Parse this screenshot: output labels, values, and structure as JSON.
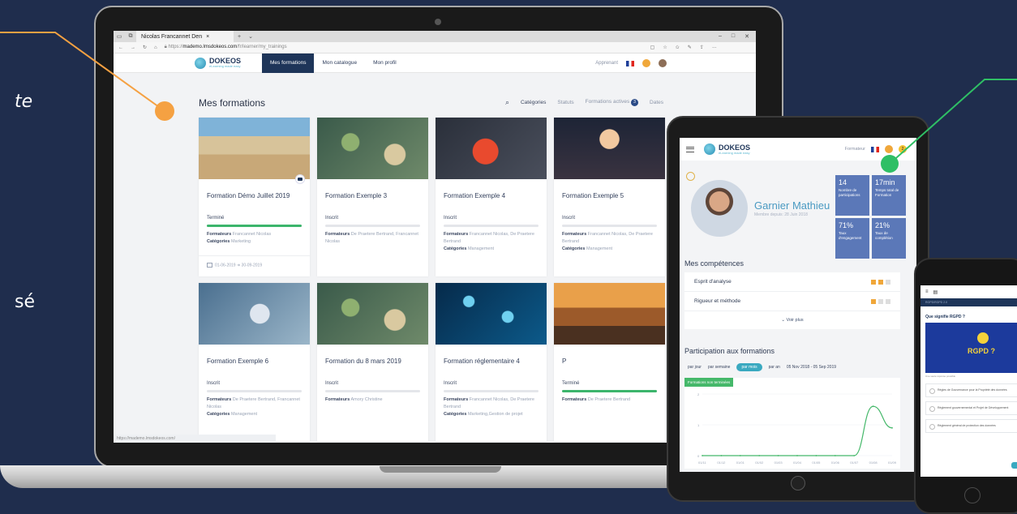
{
  "side_text": {
    "fragment_1": "te",
    "fragment_2": "sé"
  },
  "browser": {
    "tab_title": "Nicolas Francannet Den",
    "tab_close": "×",
    "tab_add": "+",
    "tab_chevron": "⌄",
    "url_prefix": "https://",
    "url_domain": "mademo.lmsdokeos.com",
    "url_path": "/fr/learner/my_trainings",
    "status_url": "https://mademo.lmsdokeos.com/"
  },
  "app": {
    "logo_name": "DOKEOS",
    "logo_tagline": "eLearning made easy",
    "nav": [
      {
        "label": "Mes formations",
        "active": true
      },
      {
        "label": "Mon catalogue",
        "active": false
      },
      {
        "label": "Mon profil",
        "active": false
      }
    ],
    "role": "Apprenant",
    "page_title": "Mes formations",
    "filters": {
      "categories": "Catégories",
      "statuts": "Statuts",
      "active": "Formations actives",
      "active_count": "3",
      "dates": "Dates"
    }
  },
  "cards": [
    {
      "title": "Formation Démo Juillet 2019",
      "status": "Terminé",
      "progress": 100,
      "formateurs": "Francannet Nicolas",
      "categories": "Marketing",
      "dates": "01-06-2019 ➜ 30-09-2019",
      "image": "beach"
    },
    {
      "title": "Formation Exemple 3",
      "status": "Inscrit",
      "progress": 0,
      "formateurs": "De Praetere Bertrand, Francannet Nicolas",
      "categories": "",
      "dates": "",
      "image": "desk"
    },
    {
      "title": "Formation Exemple 4",
      "status": "Inscrit",
      "progress": 0,
      "formateurs": "Francannet Nicolas, De Praetere Bertrand",
      "categories": "Management",
      "dates": "",
      "image": "clock"
    },
    {
      "title": "Formation Exemple 5",
      "status": "Inscrit",
      "progress": 0,
      "formateurs": "Francannet Nicolas, De Praetere Bertrand",
      "categories": "Management",
      "dates": "",
      "image": "fireworks"
    },
    {
      "title": "Formation Exemple 6",
      "status": "Inscrit",
      "progress": 0,
      "formateurs": "De Praetere Bertrand, Francannet Nicolas",
      "categories": "Management",
      "dates": "",
      "image": "tablet"
    },
    {
      "title": "Formation du 8 mars 2019",
      "status": "Inscrit",
      "progress": 0,
      "formateurs": "Amory Christine",
      "categories": "",
      "dates": "",
      "image": "desk"
    },
    {
      "title": "Formation réglementaire 4",
      "status": "Inscrit",
      "progress": 0,
      "formateurs": "Francannet Nicolas, De Praetere Bertrand",
      "categories": "Marketing,Gestion de projet",
      "dates": "",
      "image": "molecule"
    },
    {
      "title": "P",
      "status": "Terminé",
      "progress": 100,
      "formateurs": "De Praetere Bertrand",
      "categories": "",
      "dates": "",
      "image": "city"
    }
  ],
  "labels": {
    "formateurs": "Formateurs",
    "categories": "Catégories"
  },
  "tablet": {
    "role": "Formateur",
    "notif_count": "2",
    "name": "Garnier Mathieu",
    "member_since": "Membre depuis: 28 Juin 2018",
    "stats": [
      {
        "value": "14",
        "label": "Nombre de participations"
      },
      {
        "value": "17min",
        "label": "Temps total de Formation"
      },
      {
        "value": "71%",
        "label": "Taux d'engagement"
      },
      {
        "value": "21%",
        "label": "Taux de complétion"
      }
    ],
    "skills_title": "Mes compétences",
    "skills": [
      "Esprit d'analyse",
      "Rigueur et méthode"
    ],
    "voir_plus": "Voir plus",
    "participation_title": "Participation aux formations",
    "periods": [
      "par jour",
      "par semaine",
      "par mois",
      "par an"
    ],
    "active_period": "par mois",
    "range": "05 Nov 2018 - 05 Sep 2019",
    "legend": "Formations non terminées"
  },
  "chart_data": {
    "type": "line",
    "categories": [
      "01/11",
      "01/12",
      "01/01",
      "01/02",
      "01/03",
      "01/04",
      "01/05",
      "01/06",
      "01/07",
      "01/08",
      "01/09"
    ],
    "values": [
      0,
      0,
      0,
      0,
      0,
      0,
      0,
      0,
      0,
      1.6,
      0.9
    ],
    "ylim": [
      0,
      2
    ],
    "yticks": [
      "2",
      "1",
      "0"
    ],
    "color": "#45b86a"
  },
  "phone": {
    "breadcrumb": "RGPD/RGPD 2.0",
    "question": "Que signifie RGPD ?",
    "banner_text": "RGPD ?",
    "note": "Une seule réponse possible",
    "options": [
      "Règles de Gouvernance pour la Propriété des données",
      "Règlement gouvernemental et Projet de Développement",
      "Règlement général de protection des données"
    ]
  },
  "colors": {
    "background": "#1f2d4d",
    "navy": "#1e3559",
    "green": "#3cb56c",
    "teal": "#3aa9c0",
    "orange_callout": "#f5a142",
    "green_callout": "#2fbf65"
  }
}
